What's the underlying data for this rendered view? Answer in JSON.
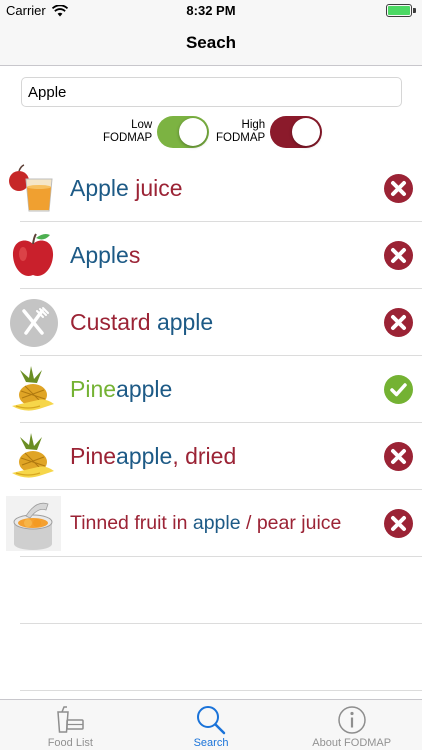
{
  "status_bar": {
    "carrier": "Carrier",
    "time": "8:32 PM"
  },
  "nav": {
    "title": "Seach"
  },
  "search": {
    "value": "Apple"
  },
  "toggles": {
    "low": {
      "label_line1": "Low",
      "label_line2": "FODMAP",
      "on": true,
      "color": "#7cb342"
    },
    "high": {
      "label_line1": "High",
      "label_line2": "FODMAP",
      "on": true,
      "color": "#8b1a2b"
    }
  },
  "colors": {
    "blue": "#1d5a86",
    "red": "#9b2335",
    "green": "#74b233",
    "accent": "#1a73d9"
  },
  "results": [
    {
      "name": "Apple juice",
      "icon": "apple-juice-icon",
      "status": "high",
      "parts": [
        {
          "t": "Apple",
          "c": "blue"
        },
        {
          "t": " juice",
          "c": "red"
        }
      ]
    },
    {
      "name": "Apples",
      "icon": "apple-icon",
      "status": "high",
      "parts": [
        {
          "t": "Apple",
          "c": "blue"
        },
        {
          "t": "s",
          "c": "red"
        }
      ]
    },
    {
      "name": "Custard apple",
      "icon": "fork-knife-icon",
      "status": "high",
      "parts": [
        {
          "t": "Custard ",
          "c": "red"
        },
        {
          "t": "apple",
          "c": "blue"
        }
      ]
    },
    {
      "name": "Pineapple",
      "icon": "pineapple-icon",
      "status": "low",
      "parts": [
        {
          "t": "Pine",
          "c": "green"
        },
        {
          "t": "apple",
          "c": "blue"
        }
      ]
    },
    {
      "name": "Pineapple, dried",
      "icon": "pineapple-icon",
      "status": "high",
      "parts": [
        {
          "t": "Pine",
          "c": "red"
        },
        {
          "t": "apple",
          "c": "blue"
        },
        {
          "t": ", dried",
          "c": "red"
        }
      ]
    },
    {
      "name": "Tinned fruit in apple / pear juice",
      "icon": "tinned-fruit-icon",
      "status": "high",
      "parts": [
        {
          "t": "Tinned fruit in ",
          "c": "red"
        },
        {
          "t": "apple",
          "c": "blue"
        },
        {
          "t": " / pear juice",
          "c": "red"
        }
      ]
    }
  ],
  "tabs": [
    {
      "label": "Food List",
      "icon": "food-list-icon",
      "active": false
    },
    {
      "label": "Search",
      "icon": "search-icon",
      "active": true
    },
    {
      "label": "About FODMAP",
      "icon": "info-icon",
      "active": false
    }
  ]
}
